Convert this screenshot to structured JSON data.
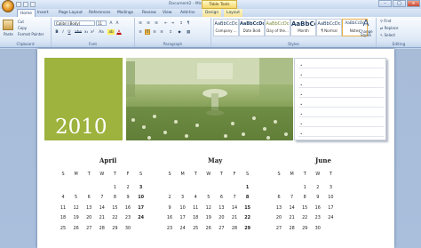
{
  "window": {
    "title": "Document2 - Microsoft Word",
    "context_tab_group": "Table Tools",
    "controls": [
      "–",
      "□",
      "x"
    ]
  },
  "tabs": [
    "Home",
    "Insert",
    "Page Layout",
    "References",
    "Mailings",
    "Review",
    "View",
    "Add-Ins",
    "Design",
    "Layout"
  ],
  "ribbon": {
    "clipboard": {
      "paste": "Paste",
      "cut": "Cut",
      "copy": "Copy",
      "format_painter": "Format Painter",
      "label": "Clipboard"
    },
    "font": {
      "name": "Calibri (Body)",
      "size": "11",
      "label": "Font",
      "tools": [
        "B",
        "I",
        "U",
        "abe",
        "x₂",
        "x²",
        "Aa",
        "ab",
        "A"
      ]
    },
    "paragraph": {
      "label": "Paragraph"
    },
    "styles": {
      "label": "Styles",
      "cards": [
        {
          "sample": "AaBbCcDc",
          "name": "Company ..."
        },
        {
          "sample": "AaBbCcDc",
          "name": "Date Bold"
        },
        {
          "sample": "AaBbCcDc",
          "name": "Day of the..."
        },
        {
          "sample": "AaBbCc",
          "name": "Month"
        },
        {
          "sample": "AaBbCcDc",
          "name": "¶ Normal"
        },
        {
          "sample": "AaBbCcDc",
          "name": "Notes"
        }
      ],
      "change_styles": "Change Styles"
    },
    "editing": {
      "find": "Find",
      "replace": "Replace",
      "select": "Select",
      "label": "Editing"
    }
  },
  "document": {
    "year": "2010",
    "notes_bullets": [
      "•",
      "•",
      "•",
      "•",
      "•",
      "•",
      "•",
      "•"
    ],
    "calendars": [
      {
        "month": "April",
        "days_header": [
          "S",
          "M",
          "T",
          "W",
          "T",
          "F",
          "S"
        ],
        "weeks": [
          [
            "",
            "",
            "",
            "",
            "1",
            "2",
            "3"
          ],
          [
            "4",
            "5",
            "6",
            "7",
            "8",
            "9",
            "10"
          ],
          [
            "11",
            "12",
            "13",
            "14",
            "15",
            "16",
            "17"
          ],
          [
            "18",
            "19",
            "20",
            "21",
            "22",
            "23",
            "24"
          ],
          [
            "25",
            "26",
            "27",
            "28",
            "29",
            "30",
            ""
          ]
        ]
      },
      {
        "month": "May",
        "days_header": [
          "S",
          "M",
          "T",
          "W",
          "T",
          "F",
          "S"
        ],
        "weeks": [
          [
            "",
            "",
            "",
            "",
            "",
            "",
            "1"
          ],
          [
            "2",
            "3",
            "4",
            "5",
            "6",
            "7",
            "8"
          ],
          [
            "9",
            "10",
            "11",
            "12",
            "13",
            "14",
            "15"
          ],
          [
            "16",
            "17",
            "18",
            "19",
            "20",
            "21",
            "22"
          ],
          [
            "23",
            "24",
            "25",
            "26",
            "27",
            "28",
            "29"
          ]
        ]
      },
      {
        "month": "June",
        "days_header": [
          "S",
          "M",
          "T",
          "W",
          "T"
        ],
        "weeks": [
          [
            "",
            "",
            "1",
            "2",
            "3"
          ],
          [
            "6",
            "7",
            "8",
            "9",
            "10"
          ],
          [
            "13",
            "14",
            "15",
            "16",
            "17"
          ],
          [
            "20",
            "21",
            "22",
            "23",
            "24"
          ],
          [
            "27",
            "28",
            "29",
            "30",
            ""
          ]
        ]
      }
    ]
  }
}
